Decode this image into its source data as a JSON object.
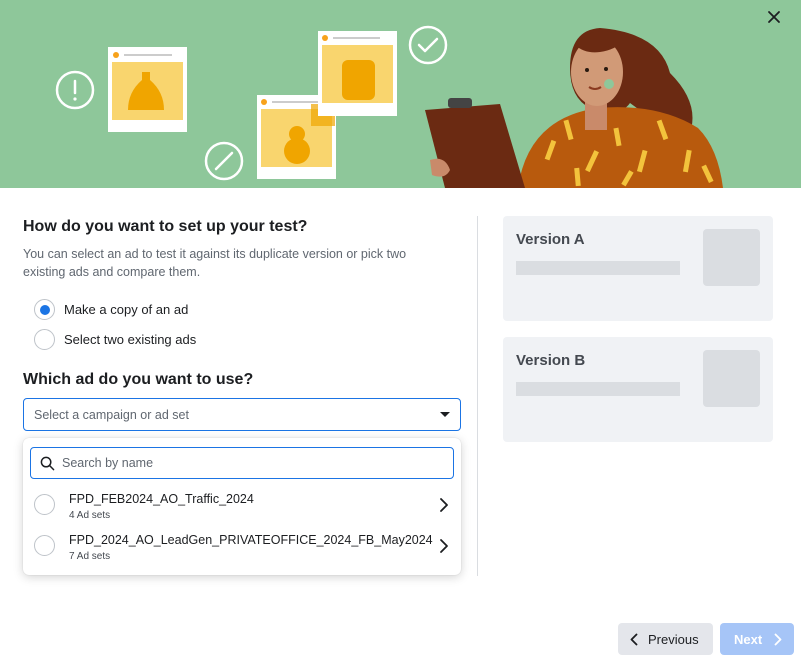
{
  "dialog": {
    "close_icon": "close-icon"
  },
  "setup": {
    "question": "How do you want to set up your test?",
    "description": "You can select an ad to test it against its duplicate version or pick two existing ads and compare them.",
    "options": [
      {
        "label": "Make a copy of an ad",
        "selected": true
      },
      {
        "label": "Select two existing ads",
        "selected": false
      }
    ]
  },
  "ad_select": {
    "question": "Which ad do you want to use?",
    "placeholder": "Select a campaign or ad set",
    "search_placeholder": "Search by name",
    "items": [
      {
        "title": "FPD_FEB2024_AO_Traffic_2024",
        "subtitle": "4 Ad sets"
      },
      {
        "title": "FPD_2024_AO_LeadGen_PRIVATEOFFICE_2024_FB_May2024",
        "subtitle": "7 Ad sets"
      }
    ]
  },
  "preview": {
    "version_a": "Version A",
    "version_b": "Version B"
  },
  "footer": {
    "previous_label": "Previous",
    "next_label": "Next"
  },
  "colors": {
    "hero_bg": "#8ec79a",
    "accent": "#1b74e4",
    "next_disabled": "#a6c5f7"
  }
}
